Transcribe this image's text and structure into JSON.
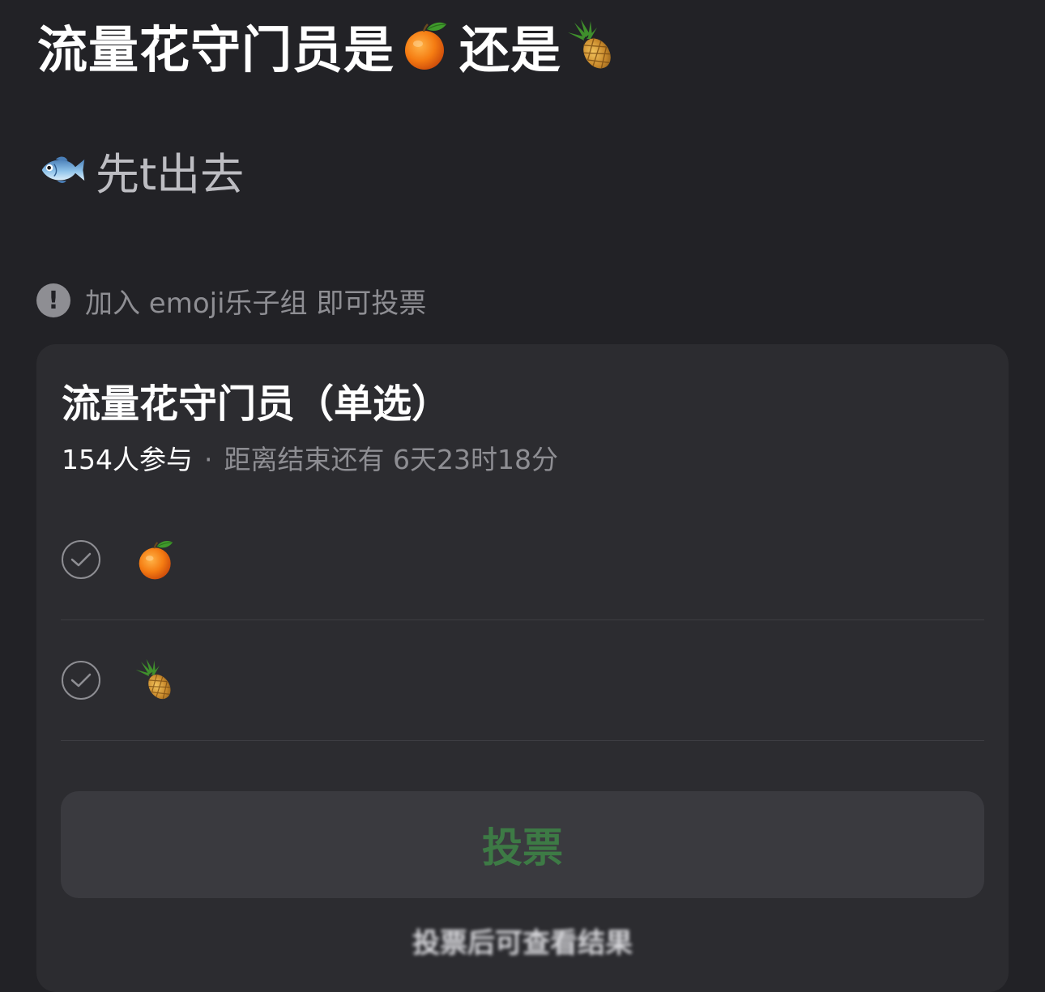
{
  "post": {
    "title_part1": "流量花守门员是",
    "title_part2": "还是",
    "title_emoji1": "orange-icon",
    "title_emoji2": "pineapple-icon",
    "body_emoji": "fish-icon",
    "body_text": "先t出去"
  },
  "notice": {
    "icon": "alert-icon",
    "text": "加入 emoji乐子组 即可投票"
  },
  "poll": {
    "title": "流量花守门员（单选）",
    "participants": "154人参与",
    "separator": "·",
    "time_left": "距离结束还有 6天23时18分",
    "options": [
      {
        "icon": "orange-icon"
      },
      {
        "icon": "pineapple-icon"
      }
    ],
    "vote_label": "投票",
    "after_vote_note": "投票后可查看结果"
  },
  "colors": {
    "background": "#222226",
    "card": "#2c2c30",
    "button": "#3a3a3f",
    "vote_text": "#3d7a45",
    "muted_text": "#8e8e93"
  }
}
